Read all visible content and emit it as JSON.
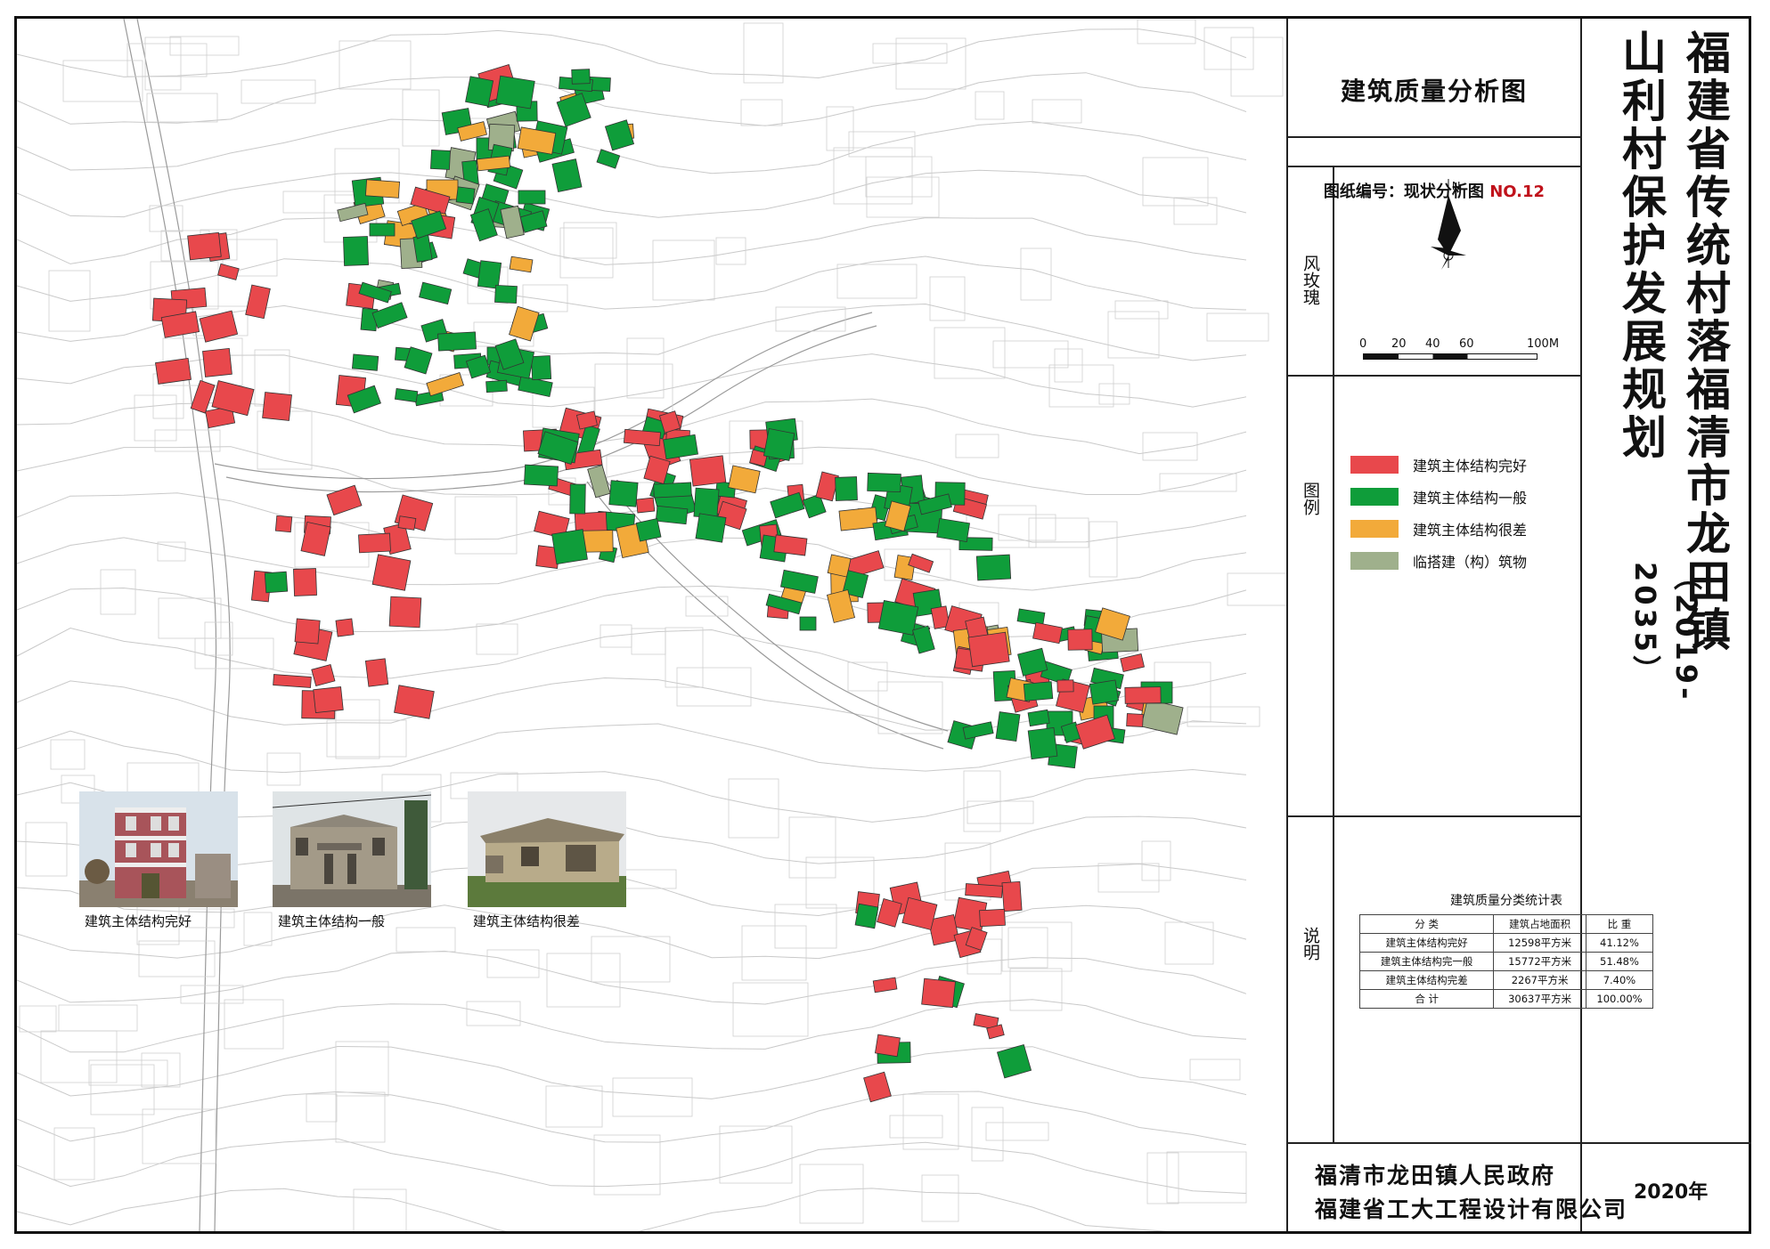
{
  "title_main": "福建省传统村落福清市龙田镇",
  "title_sub": "山利村保护发展规划",
  "title_years": "（2019-2035）",
  "map_title": "建筑质量分析图",
  "sheet_label": "图纸编号：现状分析图",
  "sheet_no": "NO.12",
  "labels": {
    "wind_rose": "风玫瑰",
    "legend": "图例",
    "notes": "说明"
  },
  "north_label": "N",
  "scale": {
    "ticks": [
      "0",
      "20",
      "40",
      "60",
      "100M"
    ]
  },
  "legend": [
    {
      "label": "建筑主体结构完好",
      "color": "#e8484c"
    },
    {
      "label": "建筑主体结构一般",
      "color": "#0f9d3a"
    },
    {
      "label": "建筑主体结构很差",
      "color": "#f2aa3a"
    },
    {
      "label": "临搭建（构）筑物",
      "color": "#9fb08c"
    }
  ],
  "stats": {
    "title": "建筑质量分类统计表",
    "headers": [
      "分 类",
      "建筑占地面积",
      "比 重"
    ],
    "rows": [
      [
        "建筑主体结构完好",
        "12598平方米",
        "41.12%"
      ],
      [
        "建筑主体结构完一般",
        "15772平方米",
        "51.48%"
      ],
      [
        "建筑主体结构完差",
        "2267平方米",
        "7.40%"
      ],
      [
        "合 计",
        "30637平方米",
        "100.00%"
      ]
    ]
  },
  "photos": [
    {
      "caption": "建筑主体结构完好"
    },
    {
      "caption": "建筑主体结构一般"
    },
    {
      "caption": "建筑主体结构很差"
    }
  ],
  "footer": {
    "org1": "福清市龙田镇人民政府",
    "org2": "福建省工大工程设计有限公司",
    "year": "2020年"
  }
}
